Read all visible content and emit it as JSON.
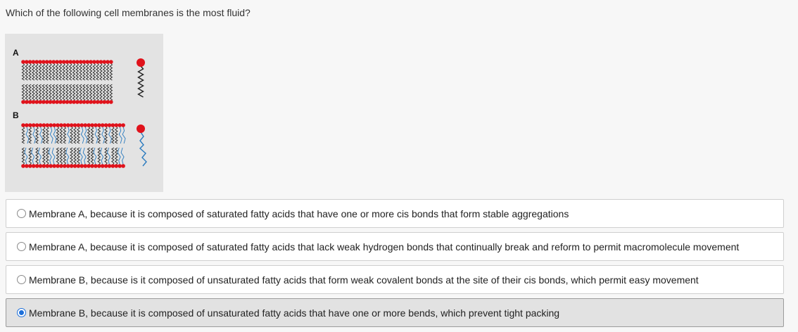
{
  "question": "Which of the following cell membranes is the most fluid?",
  "figure": {
    "label_a": "A",
    "label_b": "B",
    "head_color": "#e0121b",
    "saturated_tail_color": "#222222",
    "unsaturated_tail_color": "#2b7bbf"
  },
  "options": [
    {
      "text": "Membrane A, because it is composed of saturated fatty acids that have one or more cis bonds that form stable aggregations",
      "selected": false
    },
    {
      "text": "Membrane A, because it is composed of saturated fatty acids that lack weak hydrogen bonds that continually break and reform to permit macromolecule movement",
      "selected": false
    },
    {
      "text": "Membrane B, because is it composed of unsaturated fatty acids that form weak covalent bonds at the site of their cis bonds, which permit easy movement",
      "selected": false
    },
    {
      "text": "Membrane B, because it is composed of unsaturated fatty acids that have one or more bends, which prevent tight packing",
      "selected": true
    }
  ]
}
